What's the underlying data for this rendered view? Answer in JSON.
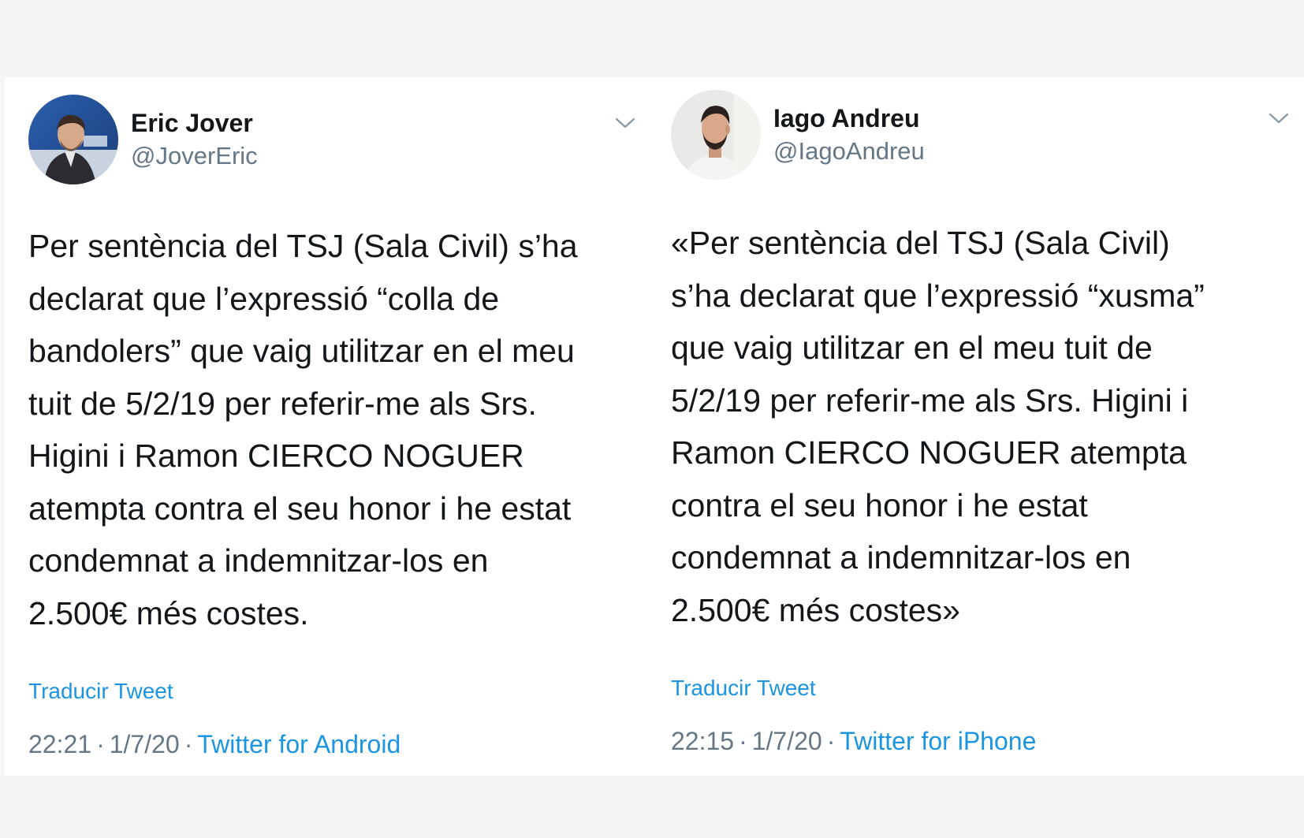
{
  "colors": {
    "name": "#14171a",
    "secondary": "#657786",
    "link": "#1b95e0",
    "background": "#f5f5f5",
    "card": "#ffffff"
  },
  "tweets": [
    {
      "author": {
        "name": "Eric Jover",
        "handle": "@JoverEric",
        "avatar_icon": "avatar-photo"
      },
      "menu_icon": "chevron-down-icon",
      "text": "Per sentència del TSJ (Sala Civil) s’ha\ndeclarat que l’expressió “colla de\nbandolers” que vaig utilitzar en el meu\ntuit de 5/2/19 per referir-me als Srs.\nHigini i Ramon CIERCO NOGUER\natempta contra el seu honor i he estat\ncondemnat a indemnitzar-los en\n2.500€ més costes.",
      "translate_label": "Traducir Tweet",
      "time": "22:21",
      "date": "1/7/20",
      "source": "Twitter for Android"
    },
    {
      "author": {
        "name": "Iago Andreu",
        "handle": "@IagoAndreu",
        "avatar_icon": "avatar-photo"
      },
      "menu_icon": "chevron-down-icon",
      "text": "«Per sentència del TSJ (Sala Civil)\ns’ha declarat que l’expressió “xusma”\nque vaig utilitzar en el meu tuit de\n5/2/19 per referir-me als Srs. Higini i\nRamon CIERCO NOGUER atempta\ncontra el seu honor i he estat\ncondemnat a indemnitzar-los en\n2.500€ més costes»",
      "translate_label": "Traducir Tweet",
      "time": "22:15",
      "date": "1/7/20",
      "source": "Twitter for iPhone"
    }
  ]
}
